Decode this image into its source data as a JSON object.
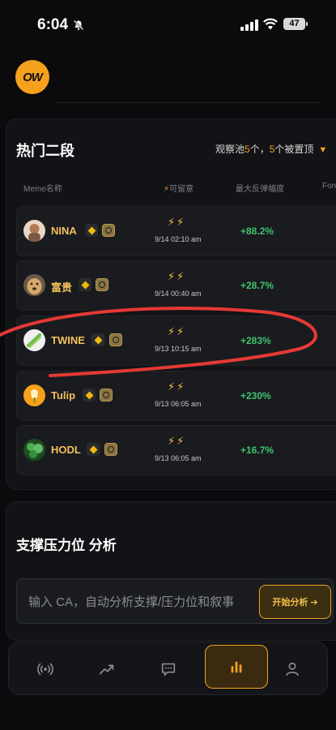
{
  "status_bar": {
    "time": "6:04",
    "battery": "47",
    "icons": [
      "bell-slash-icon",
      "signal-icon",
      "wifi-icon",
      "battery-icon"
    ]
  },
  "header": {
    "logo_text": "OW"
  },
  "hot_section": {
    "title": "热门二段",
    "pool_info": {
      "prefix": "观察池",
      "count1": "5",
      "mid": "个，",
      "count2": "5",
      "suffix": "个被置顶"
    },
    "columns": {
      "name": "Meme名称",
      "stay_icon": "⚡",
      "stay": "可留意",
      "rebound": "最大反弹幅度",
      "extra": "Fon"
    },
    "rows": [
      {
        "name": "NINA",
        "bolts": "⚡⚡",
        "time": "9/14 02:10 am",
        "rebound": "+88.2%",
        "avatar_color": "#e9d7c6"
      },
      {
        "name": "富贵",
        "bolts": "⚡⚡",
        "time": "9/14 00:40 am",
        "rebound": "+28.7%",
        "avatar_color": "#c89a5a"
      },
      {
        "name": "TWINE",
        "bolts": "⚡⚡",
        "time": "9/13 10:15 am",
        "rebound": "+283%",
        "avatar_color": "#f0f0f0"
      },
      {
        "name": "Tulip",
        "bolts": "⚡⚡",
        "time": "9/13 06:05 am",
        "rebound": "+230%",
        "avatar_color": "#f5a11c"
      },
      {
        "name": "HODL",
        "bolts": "⚡⚡",
        "time": "9/13 06:05 am",
        "rebound": "+16.7%",
        "avatar_color": "#2e7d32"
      }
    ]
  },
  "analysis": {
    "title": "支撑压力位 分析",
    "input_placeholder": "输入 CA，自动分析支撑/压力位和叙事",
    "start_button": "开始分析 ➔"
  },
  "nav": {
    "items": [
      "broadcast-icon",
      "trend-icon",
      "chat-icon",
      "bar-chart-icon",
      "user-icon"
    ],
    "active": "bar-chart-icon"
  },
  "colors": {
    "accent": "#f5a11c",
    "positive": "#3ec46d",
    "token_name": "#f3c05a",
    "annotation": "#e53935"
  }
}
